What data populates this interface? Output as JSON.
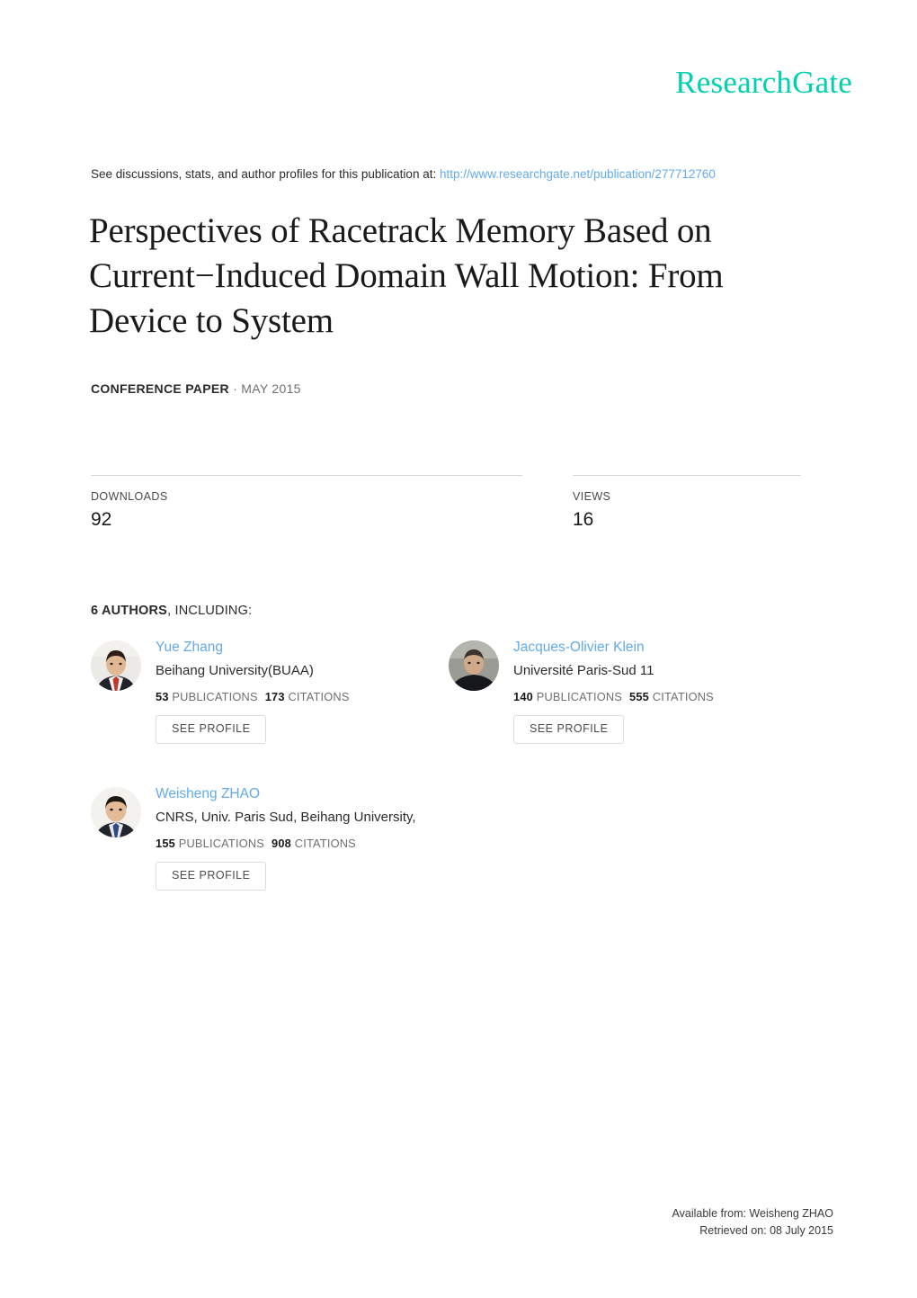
{
  "brand": {
    "logo_text": "ResearchGate",
    "logo_color": "#00cfb0"
  },
  "discussion": {
    "prefix": "See discussions, stats, and author profiles for this publication at: ",
    "url": "http://www.researchgate.net/publication/277712760",
    "link_color": "#63abe8"
  },
  "publication": {
    "title": "Perspectives of Racetrack Memory Based on Current−Induced Domain Wall Motion: From Device to System",
    "type": "CONFERENCE PAPER",
    "date": "· MAY 2015"
  },
  "stats": {
    "downloads": {
      "label": "DOWNLOADS",
      "value": "92"
    },
    "views": {
      "label": "VIEWS",
      "value": "16"
    }
  },
  "authors_section": {
    "count_label": "6 AUTHORS",
    "rest_label": ", INCLUDING:",
    "see_profile_label": "SEE PROFILE",
    "publications_label": "PUBLICATIONS",
    "citations_label": "CITATIONS",
    "authors": [
      {
        "name": "Yue Zhang",
        "affiliation": "Beihang University(BUAA)",
        "publications": "53",
        "citations": "173",
        "see_profile": "SEE PROFILE",
        "avatar_bg": "#eceae6",
        "avatar_skin": "#e0b894",
        "avatar_hair": "#2a2018",
        "avatar_suit": "#22232a",
        "avatar_shirt": "#f2f2f2",
        "avatar_tie": "#c0392b"
      },
      {
        "name": "Jacques-Olivier Klein",
        "affiliation": "Université Paris-Sud 11",
        "publications": "140",
        "citations": "555",
        "see_profile": "SEE PROFILE",
        "avatar_bg": "#9a9b93",
        "avatar_skin": "#cfa98a",
        "avatar_hair": "#3b332c",
        "avatar_suit": "#16171c",
        "avatar_shirt": "#16171c",
        "avatar_tie": "#16171c"
      },
      {
        "name": "Weisheng ZHAO",
        "affiliation": "CNRS, Univ. Paris Sud, Beihang University,",
        "publications": "155",
        "citations": "908",
        "see_profile": "SEE PROFILE",
        "avatar_bg": "#f4f2ee",
        "avatar_skin": "#e3bb97",
        "avatar_hair": "#1d1711",
        "avatar_suit": "#23242b",
        "avatar_shirt": "#e9e9e9",
        "avatar_tie": "#2c4b86"
      }
    ]
  },
  "footer": {
    "available_from": "Available from: Weisheng ZHAO",
    "retrieved_on": "Retrieved on: 08 July 2015"
  }
}
